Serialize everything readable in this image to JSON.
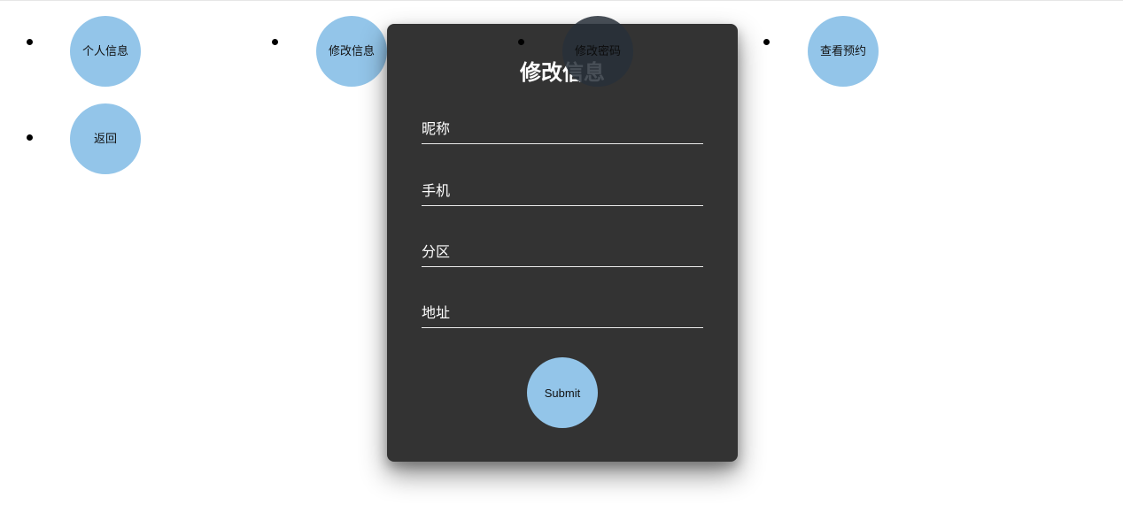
{
  "nav": {
    "items": [
      {
        "label": "个人信息"
      },
      {
        "label": "修改信息"
      },
      {
        "label": "修改密码"
      },
      {
        "label": "查看预约"
      },
      {
        "label": "返回"
      }
    ]
  },
  "form": {
    "title": "修改信息",
    "fields": [
      {
        "label": "昵称",
        "value": ""
      },
      {
        "label": "手机",
        "value": ""
      },
      {
        "label": "分区",
        "value": ""
      },
      {
        "label": "地址",
        "value": ""
      }
    ],
    "submit_label": "Submit"
  },
  "colors": {
    "nav_circle": "#93c5e9",
    "modal_bg": "#333333",
    "text_light": "#ffffff"
  }
}
